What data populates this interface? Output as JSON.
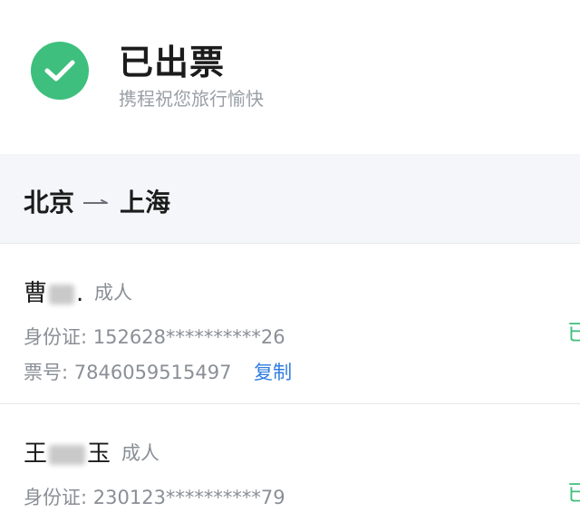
{
  "header": {
    "title": "已出票",
    "subtitle": "携程祝您旅行愉快",
    "icon": "check-circle-icon",
    "accent_color": "#3ebf7d"
  },
  "route": {
    "from": "北京",
    "to": "上海"
  },
  "passengers": [
    {
      "name_first": "曹",
      "name_last": ".",
      "type": "成人",
      "id_label": "身份证:",
      "id_value": "152628**********26",
      "ticket_label": "票号:",
      "ticket_value": "7846059515497",
      "copy_label": "复制",
      "status_partial": "已"
    },
    {
      "name_first": "王",
      "name_last": "玉",
      "type": "成人",
      "id_label": "身份证:",
      "id_value": "230123**********79",
      "status_partial": "已"
    }
  ],
  "colors": {
    "link": "#2f7de1",
    "muted": "#8a8f96",
    "route_bg": "#f4f6fa"
  }
}
